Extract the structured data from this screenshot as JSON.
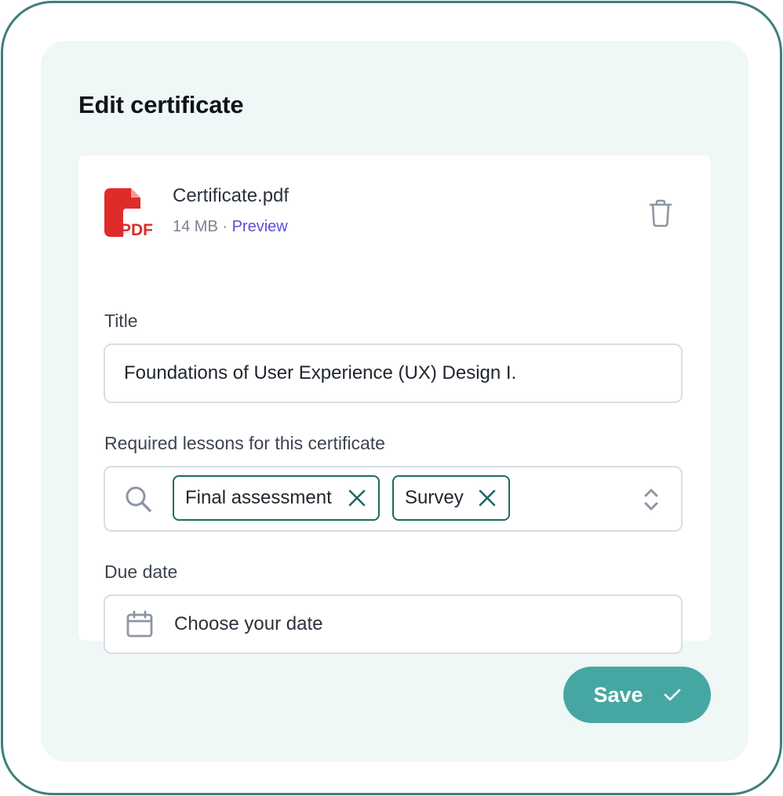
{
  "dialog": {
    "title": "Edit certificate"
  },
  "file": {
    "name": "Certificate.pdf",
    "size": "14 MB",
    "separator": " · ",
    "preview_label": "Preview",
    "icon": "pdf-file-icon",
    "badge": "PDF"
  },
  "form": {
    "title_label": "Title",
    "title_value": "Foundations of User Experience (UX) Design I.",
    "lessons_label": "Required lessons for this certificate",
    "lessons": [
      {
        "label": "Final assessment"
      },
      {
        "label": "Survey"
      }
    ],
    "due_label": "Due date",
    "due_placeholder": "Choose your date"
  },
  "actions": {
    "save_label": "Save"
  },
  "colors": {
    "frame": "#3c7f7b",
    "panel_bg": "#eff7f7",
    "accent": "#46a7a2",
    "chip_border": "#1c6b63",
    "link": "#5b4fd6",
    "pdf_red": "#e02b2b"
  }
}
